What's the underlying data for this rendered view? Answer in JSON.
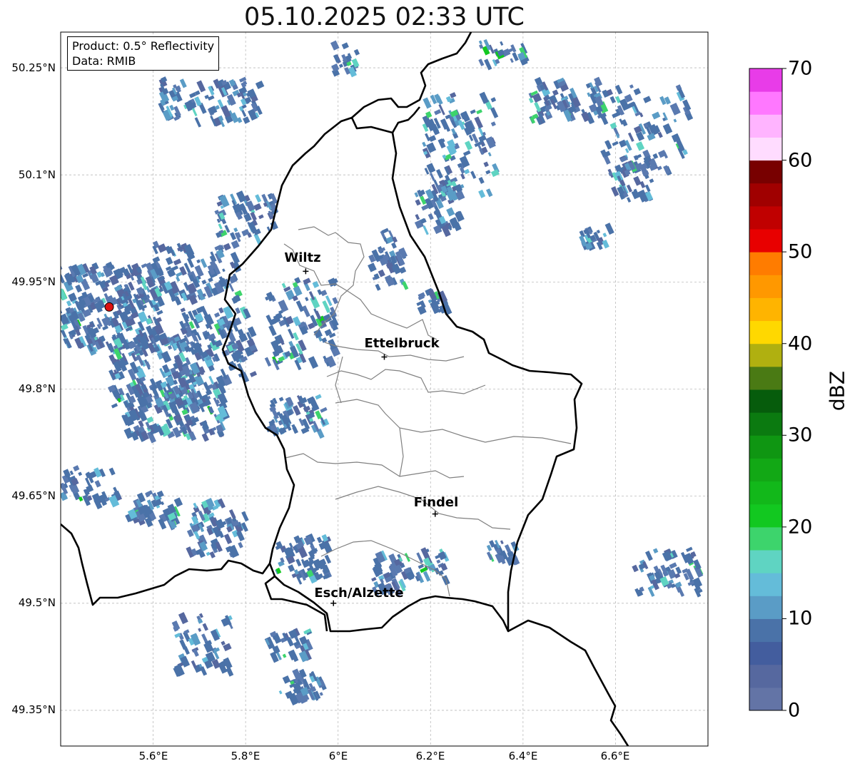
{
  "title": "05.10.2025 02:33 UTC",
  "infobox": {
    "product": "Product: 0.5° Reflectivity",
    "data_source": "Data: RMIB"
  },
  "axes": {
    "lat_ticks": [
      "50.25°N",
      "50.1°N",
      "49.95°N",
      "49.8°N",
      "49.65°N",
      "49.5°N",
      "49.35°N"
    ],
    "lon_ticks": [
      "5.6°E",
      "5.8°E",
      "6°E",
      "6.2°E",
      "6.4°E",
      "6.6°E"
    ],
    "grid": true
  },
  "cities": [
    {
      "name": "Wiltz",
      "lon": 5.93,
      "lat": 49.965
    },
    {
      "name": "Ettelbruck",
      "lon": 6.1,
      "lat": 49.845
    },
    {
      "name": "Findel",
      "lon": 6.21,
      "lat": 49.625
    },
    {
      "name": "Esch/Alzette",
      "lon": 5.99,
      "lat": 49.5
    }
  ],
  "radar_site": {
    "lon": 5.505,
    "lat": 49.915,
    "color": "#dd1111"
  },
  "colorbar": {
    "label": "dBZ",
    "min": 0,
    "max": 70,
    "tick_labels": [
      "0",
      "10",
      "20",
      "30",
      "40",
      "50",
      "60",
      "70"
    ],
    "colors": [
      "#6374a6",
      "#56689f",
      "#435d9e",
      "#4a72a8",
      "#5a9cc6",
      "#64bcd9",
      "#5fd4c2",
      "#3dd46c",
      "#12c820",
      "#12b81a",
      "#12a815",
      "#0f9612",
      "#0b7a10",
      "#065c0c",
      "#4a7a14",
      "#b0b010",
      "#ffd800",
      "#ffb400",
      "#ff9800",
      "#ff7c00",
      "#e80000",
      "#c00000",
      "#a00000",
      "#780000",
      "#ffdcff",
      "#ffb4ff",
      "#ff78ff",
      "#e83ce8"
    ]
  },
  "colors": {
    "grid": "#bbbbbb",
    "country_border": "#000000",
    "canton_border": "#808080"
  }
}
